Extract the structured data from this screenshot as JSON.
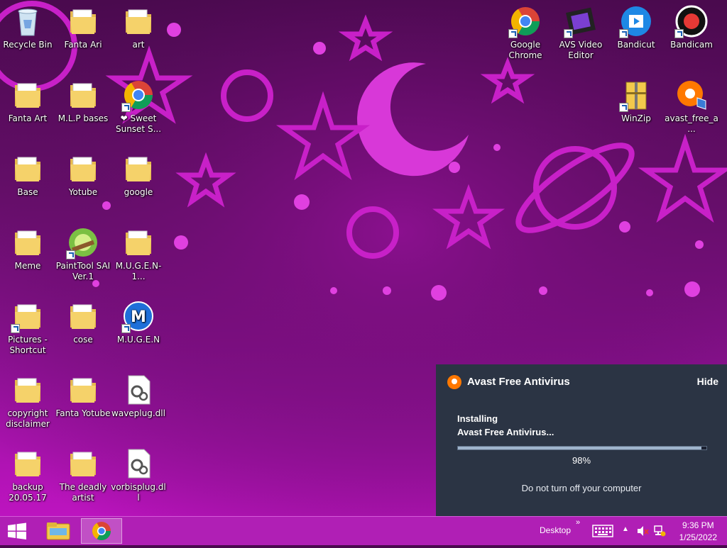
{
  "desktop": {
    "icons_left": [
      {
        "id": "recycle-bin",
        "label": "Recycle Bin",
        "type": "recycle"
      },
      {
        "id": "fanta-ari",
        "label": "Fanta Ari",
        "type": "folder"
      },
      {
        "id": "art",
        "label": "art",
        "type": "folder"
      },
      {
        "id": "fanta-art",
        "label": "Fanta Art",
        "type": "folder"
      },
      {
        "id": "mlp-bases",
        "label": "M.L.P bases",
        "type": "folder"
      },
      {
        "id": "sweet-sunset",
        "label": "❤ Sweet Sunset S...",
        "type": "chrome-shortcut"
      },
      {
        "id": "base",
        "label": "Base",
        "type": "folder"
      },
      {
        "id": "yotube",
        "label": "Yotube",
        "type": "folder"
      },
      {
        "id": "google",
        "label": "google",
        "type": "folder"
      },
      {
        "id": "meme",
        "label": "Meme",
        "type": "folder"
      },
      {
        "id": "painttool-sai",
        "label": "PaintTool SAI Ver.1",
        "type": "app-shortcut"
      },
      {
        "id": "mugen-folder",
        "label": "M.U.G.E.N-1...",
        "type": "folder"
      },
      {
        "id": "pictures-shortcut",
        "label": "Pictures - Shortcut",
        "type": "folder-shortcut"
      },
      {
        "id": "cose",
        "label": "cose",
        "type": "folder"
      },
      {
        "id": "mugen-app",
        "label": "M.U.G.E.N",
        "type": "mugen-shortcut"
      },
      {
        "id": "copyright-disclaimer",
        "label": "copyright disclaimer",
        "type": "folder"
      },
      {
        "id": "fanta-yotube",
        "label": "Fanta Yotube",
        "type": "folder"
      },
      {
        "id": "waveplug",
        "label": "waveplug.dll",
        "type": "dll"
      },
      {
        "id": "backup",
        "label": "backup 20.05.17",
        "type": "folder"
      },
      {
        "id": "deadly-artist",
        "label": "The deadly artist",
        "type": "folder"
      },
      {
        "id": "vorbisplug",
        "label": "vorbisplug.dll",
        "type": "dll"
      }
    ],
    "icons_right": [
      {
        "id": "google-chrome",
        "label": "Google Chrome",
        "type": "chrome-shortcut"
      },
      {
        "id": "avs-video-editor",
        "label": "AVS Video Editor",
        "type": "film-shortcut"
      },
      {
        "id": "bandicut",
        "label": "Bandicut",
        "type": "bandicut-shortcut"
      },
      {
        "id": "bandicam",
        "label": "Bandicam",
        "type": "bandicam-shortcut"
      },
      {
        "id": "winzip",
        "label": "WinZip",
        "type": "winzip-shortcut"
      },
      {
        "id": "avast-installer",
        "label": "avast_free_a...",
        "type": "avast-installer"
      }
    ]
  },
  "avast_popup": {
    "title": "Avast Free Antivirus",
    "hide_label": "Hide",
    "status_line1": "Installing",
    "status_line2": "Avast Free Antivirus...",
    "progress": 0.98,
    "percent_text": "98%",
    "notice": "Do not turn off your computer"
  },
  "taskbar": {
    "desktop_label": "Desktop",
    "time": "9:36 PM",
    "date": "1/25/2022",
    "pinned": [
      "file-explorer-icon",
      "chrome-icon"
    ]
  },
  "colors": {
    "taskbar": "#b01fb5",
    "popup_bg": "#2b3444",
    "avast_orange": "#ff7800"
  }
}
